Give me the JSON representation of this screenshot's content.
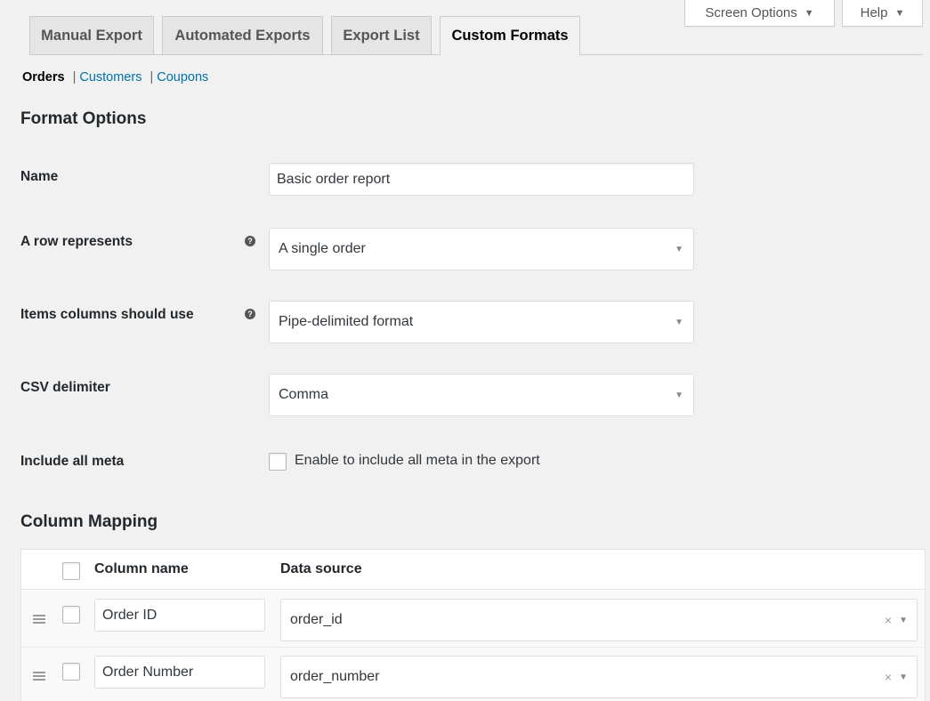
{
  "meta": {
    "screen_options": "Screen Options",
    "help": "Help"
  },
  "tabs": [
    {
      "label": "Manual Export",
      "active": false
    },
    {
      "label": "Automated Exports",
      "active": false
    },
    {
      "label": "Export List",
      "active": false
    },
    {
      "label": "Custom Formats",
      "active": true
    }
  ],
  "subnav": {
    "orders": "Orders",
    "customers": "Customers",
    "coupons": "Coupons",
    "separator": "|"
  },
  "format_options": {
    "heading": "Format Options",
    "name_label": "Name",
    "name_value": "Basic order report",
    "row_label": "A row represents",
    "row_value": "A single order",
    "items_label": "Items columns should use",
    "items_value": "Pipe-delimited format",
    "csv_label": "CSV delimiter",
    "csv_value": "Comma",
    "meta_label": "Include all meta",
    "meta_checkbox_label": "Enable to include all meta in the export",
    "help_glyph": "?"
  },
  "mapping": {
    "heading": "Column Mapping",
    "col_name_header": "Column name",
    "data_source_header": "Data source",
    "rows": [
      {
        "column_name": "Order ID",
        "data_source": "order_id"
      },
      {
        "column_name": "Order Number",
        "data_source": "order_number"
      }
    ],
    "clear_glyph": "×",
    "arrow_glyph": "▼"
  }
}
